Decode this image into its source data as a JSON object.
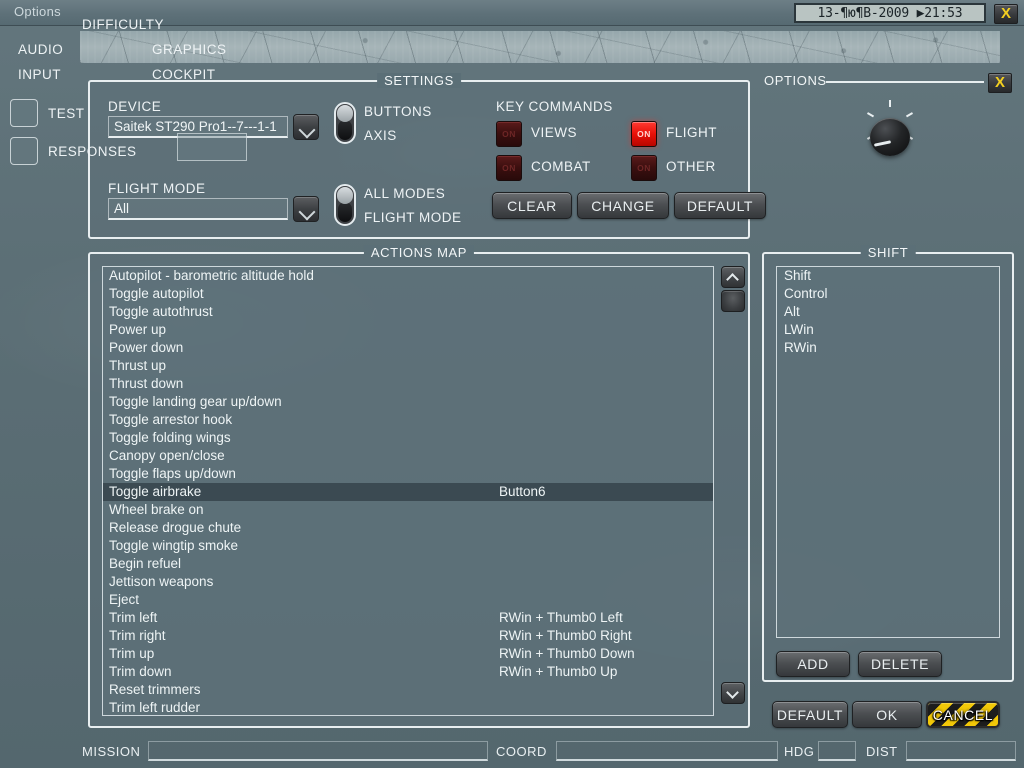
{
  "window": {
    "title": "Options",
    "datetime": "13-¶ю¶В-2009 ▶21:53",
    "close_label": "X"
  },
  "settings": {
    "legend": "SETTINGS",
    "device_label": "DEVICE",
    "device_value": "Saitek ST290 Pro1--7---1-1",
    "flight_mode_label": "FLIGHT MODE",
    "flight_mode_value": "All",
    "switch_buttons_label": "BUTTONS",
    "switch_axis_label": "AXIS",
    "switch_allmodes_label": "ALL MODES",
    "switch_flightmode_label": "FLIGHT MODE",
    "key_commands_label": "KEY COMMANDS",
    "toggles": [
      {
        "name": "views",
        "label": "VIEWS",
        "state": "ON",
        "lit": false
      },
      {
        "name": "flight",
        "label": "FLIGHT",
        "state": "ON",
        "lit": true
      },
      {
        "name": "combat",
        "label": "COMBAT",
        "state": "ON",
        "lit": false
      },
      {
        "name": "other",
        "label": "OTHER",
        "state": "ON",
        "lit": false
      }
    ],
    "clear_label": "CLEAR",
    "change_label": "CHANGE",
    "default_label": "DEFAULT"
  },
  "options": {
    "legend": "OPTIONS",
    "close_label": "X",
    "knob_labels": {
      "top": "DIFFICULTY",
      "left": "AUDIO",
      "right": "GRAPHICS",
      "bottom_left": "INPUT",
      "bottom_right": "COCKPIT"
    },
    "selected": "INPUT",
    "test_label": "TEST",
    "responses_label": "RESPONSES",
    "responses_value": ""
  },
  "actions_map": {
    "legend": "ACTIONS MAP",
    "rows": [
      {
        "action": "Autopilot - barometric altitude hold",
        "binding": "",
        "selected": false
      },
      {
        "action": "Toggle autopilot",
        "binding": "",
        "selected": false
      },
      {
        "action": "Toggle autothrust",
        "binding": "",
        "selected": false
      },
      {
        "action": "Power up",
        "binding": "",
        "selected": false
      },
      {
        "action": "Power down",
        "binding": "",
        "selected": false
      },
      {
        "action": "Thrust up",
        "binding": "",
        "selected": false
      },
      {
        "action": "Thrust down",
        "binding": "",
        "selected": false
      },
      {
        "action": "Toggle landing gear up/down",
        "binding": "",
        "selected": false
      },
      {
        "action": "Toggle arrestor hook",
        "binding": "",
        "selected": false
      },
      {
        "action": "Toggle folding wings",
        "binding": "",
        "selected": false
      },
      {
        "action": "Canopy open/close",
        "binding": "",
        "selected": false
      },
      {
        "action": "Toggle flaps up/down",
        "binding": "",
        "selected": false
      },
      {
        "action": "Toggle airbrake",
        "binding": "Button6",
        "selected": true
      },
      {
        "action": "Wheel brake on",
        "binding": "",
        "selected": false
      },
      {
        "action": "Release drogue chute",
        "binding": "",
        "selected": false
      },
      {
        "action": "Toggle wingtip smoke",
        "binding": "",
        "selected": false
      },
      {
        "action": "Begin refuel",
        "binding": "",
        "selected": false
      },
      {
        "action": "Jettison weapons",
        "binding": "",
        "selected": false
      },
      {
        "action": "Eject",
        "binding": "",
        "selected": false
      },
      {
        "action": "Trim left",
        "binding": "RWin + Thumb0 Left",
        "selected": false
      },
      {
        "action": "Trim right",
        "binding": "RWin + Thumb0 Right",
        "selected": false
      },
      {
        "action": "Trim up",
        "binding": "RWin + Thumb0 Down",
        "selected": false
      },
      {
        "action": "Trim down",
        "binding": "RWin + Thumb0 Up",
        "selected": false
      },
      {
        "action": "Reset trimmers",
        "binding": "",
        "selected": false
      },
      {
        "action": "Trim left rudder",
        "binding": "",
        "selected": false
      }
    ]
  },
  "shift": {
    "legend": "SHIFT",
    "items": [
      "Shift",
      "Control",
      "Alt",
      "LWin",
      "RWin"
    ],
    "add_label": "ADD",
    "delete_label": "DELETE"
  },
  "dialog_buttons": {
    "default_label": "DEFAULT",
    "ok_label": "OK",
    "cancel_label": "CANCEL"
  },
  "statusbar": {
    "mission_label": "MISSION",
    "mission_value": "",
    "coord_label": "COORD",
    "coord_value": "",
    "hdg_label": "HDG",
    "hdg_value": "",
    "dist_label": "DIST",
    "dist_value": ""
  },
  "colors": {
    "background": "#5c7078",
    "accent_red": "#e81008",
    "accent_yellow": "#f4d020",
    "selection": "#3b4a52",
    "text": "#eef4f5"
  }
}
